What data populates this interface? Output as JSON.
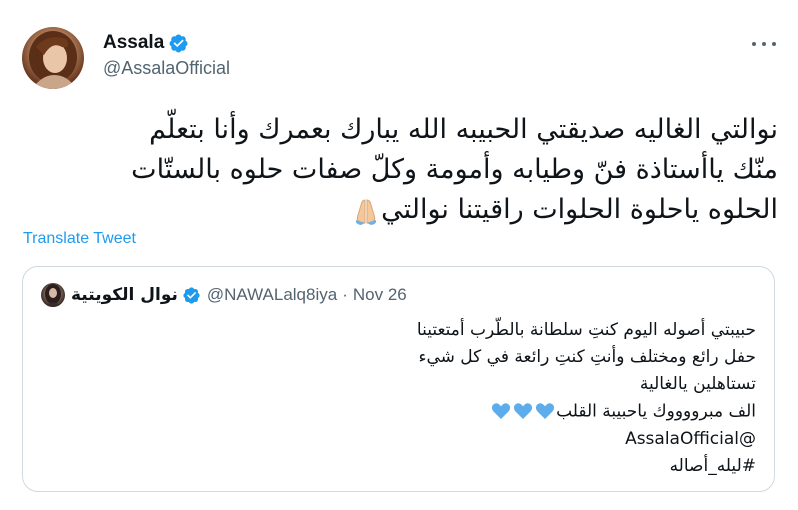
{
  "tweet": {
    "display_name": "Assala",
    "handle": "@AssalaOfficial",
    "text_lines": [
      "نوالتي الغاليه صديقتي الحبيبه الله يبارك بعمرك وأنا بتعلّم",
      "منّك ياأستاذة فنّ وطيابه وأمومة وكلّ صفات حلوه بالستّات",
      "الحلوه ياحلوة الحلوات راقيتنا نوالتي"
    ],
    "emoji_end": "folded-hands-emoji",
    "translate_label": "Translate Tweet",
    "more_icon": "more-horizontal-icon",
    "verified_icon": "verified-badge-icon"
  },
  "quote": {
    "display_name": "نوال الكويتية",
    "handle": "@NAWALalq8iya",
    "separator": "·",
    "date": "Nov 26",
    "lines": [
      "حبيبتي أصوله اليوم كنتِ سلطانة بالطّرب أمتعتينا",
      "حفل رائع ومختلف وأنتِ كنتِ رائعة في كل شيء",
      "تستاهلين يالغالية",
      "الف مبرووووك ياحبيبة القلب",
      "@AssalaOfficial",
      "#ليله_أصاله"
    ],
    "hearts_count": 3,
    "heart_color": "#5dadec"
  },
  "colors": {
    "accent": "#1d9bf0",
    "text": "#0f1419",
    "secondary": "#536471",
    "border": "#cfd9de"
  }
}
